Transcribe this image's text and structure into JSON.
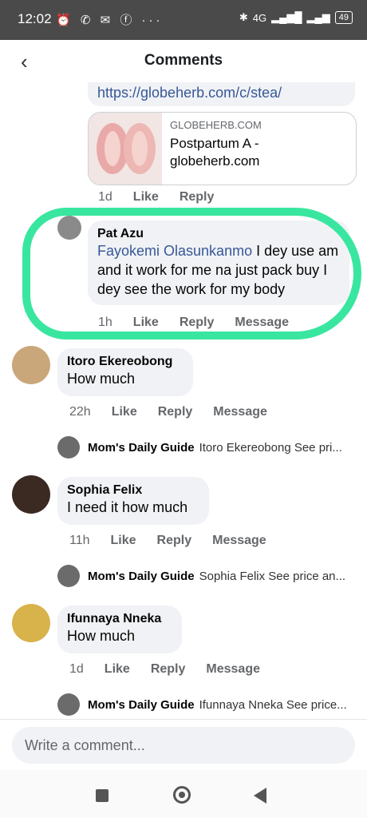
{
  "status": {
    "time": "12:02",
    "icons": "⏰ ✆ ✉ ⓕ ···",
    "network": "4G",
    "battery": "49"
  },
  "header": {
    "title": "Comments",
    "back_icon": "‹"
  },
  "link_post": {
    "url_text": "https://globeherb.com/c/stea/",
    "domain": "GLOBEHERB.COM",
    "card_title": "Postpartum A - globeherb.com",
    "time": "1d",
    "like": "Like",
    "reply": "Reply"
  },
  "comments": [
    {
      "name": "Pat Azu",
      "mention": "Fayokemi Olasunkanmo",
      "text": " I dey use am and it work for  me na just pack buy I dey see the work for my body",
      "time": "1h",
      "like": "Like",
      "reply": "Reply",
      "message": "Message"
    },
    {
      "name": "Itoro Ekereobong",
      "text": "How much",
      "time": "22h",
      "like": "Like",
      "reply": "Reply",
      "message": "Message",
      "reply_author": "Mom's Daily Guide",
      "reply_text": "Itoro Ekereobong  See pri..."
    },
    {
      "name": "Sophia Felix",
      "text": "I need it how much",
      "time": "11h",
      "like": "Like",
      "reply": "Reply",
      "message": "Message",
      "reply_author": "Mom's Daily Guide",
      "reply_text": "Sophia Felix See price an..."
    },
    {
      "name": "Ifunnaya Nneka",
      "text": "How much",
      "time": "1d",
      "like": "Like",
      "reply": "Reply",
      "message": "Message",
      "reply_author": "Mom's Daily Guide",
      "reply_text": "Ifunnaya Nneka See price..."
    }
  ],
  "composer": {
    "placeholder": "Write a comment..."
  },
  "colors": {
    "highlight": "#39e6a0",
    "link": "#385898",
    "bubble": "#f0f2f5"
  }
}
